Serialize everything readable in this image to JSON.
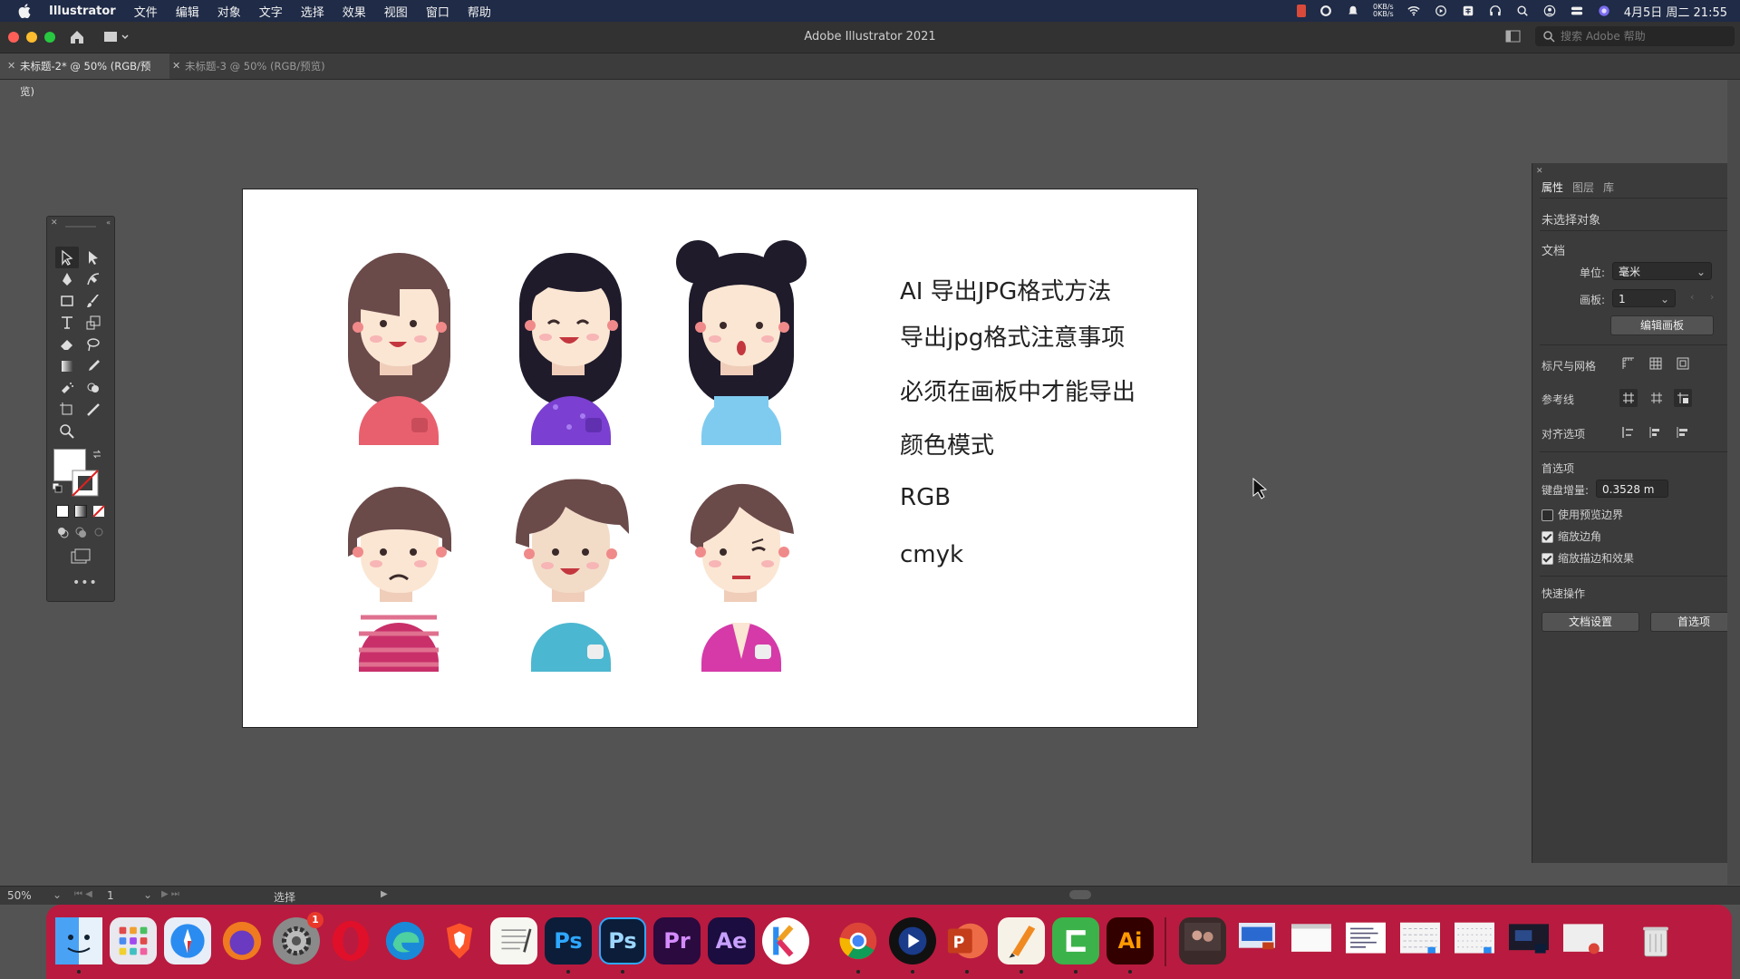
{
  "menubar": {
    "app_name": "Illustrator",
    "items": [
      "文件",
      "编辑",
      "对象",
      "文字",
      "选择",
      "效果",
      "视图",
      "窗口",
      "帮助"
    ],
    "net_up": "0KB/s",
    "net_down": "0KB/s",
    "datetime": "4月5日 周二 21:55"
  },
  "window": {
    "title": "Adobe Illustrator 2021",
    "help_search_placeholder": "搜索 Adobe 帮助"
  },
  "doc_tabs": [
    {
      "label": "未标题-2* @ 50% (RGB/预览)",
      "active": true
    },
    {
      "label": "未标题-3 @ 50% (RGB/预览)",
      "active": false
    }
  ],
  "artboard_text": {
    "line1": "AI 导出JPG格式方法",
    "line2": "导出jpg格式注意事项",
    "line3": "必须在画板中才能导出",
    "line4": "颜色模式",
    "line5": "RGB",
    "line6": "cmyk"
  },
  "panel": {
    "tabs": [
      "属性",
      "图层",
      "库"
    ],
    "no_selection": "未选择对象",
    "doc_section": "文档",
    "unit_label": "单位:",
    "unit_value": "毫米",
    "artboard_label": "画板:",
    "artboard_value": "1",
    "edit_artboard_btn": "编辑画板",
    "rulers_grid": "标尺与网格",
    "guides": "参考线",
    "align_options": "对齐选项",
    "prefs": "首选项",
    "keyboard_increment_label": "键盘增量:",
    "keyboard_increment_value": "0.3528 m",
    "use_preview_bounds": "使用预览边界",
    "scale_corners": "缩放边角",
    "scale_strokes": "缩放描边和效果",
    "quick_actions": "快速操作",
    "doc_settings_btn": "文档设置",
    "prefs_btn": "首选项",
    "checkboxes": {
      "use_preview_bounds": false,
      "scale_corners": true,
      "scale_strokes": true
    }
  },
  "statusbar": {
    "zoom": "50%",
    "artboard_num": "1",
    "tool_name": "选择"
  },
  "dock": {
    "apps": [
      "Finder",
      "Launchpad",
      "Safari",
      "Firefox",
      "System Preferences",
      "Opera",
      "Edge",
      "Brave",
      "TextEdit",
      "Ps",
      "Ps",
      "Pr",
      "Ae",
      "Keynote",
      "Chrome",
      "Screen Recorder",
      "PowerPoint",
      "Pages",
      "Camtasia",
      "Ai"
    ],
    "badge": "1"
  },
  "colors": {
    "menubar": "#1f2b47",
    "dock": "#b81b3f",
    "canvas": "#535353",
    "panel": "#3b3b3b"
  }
}
